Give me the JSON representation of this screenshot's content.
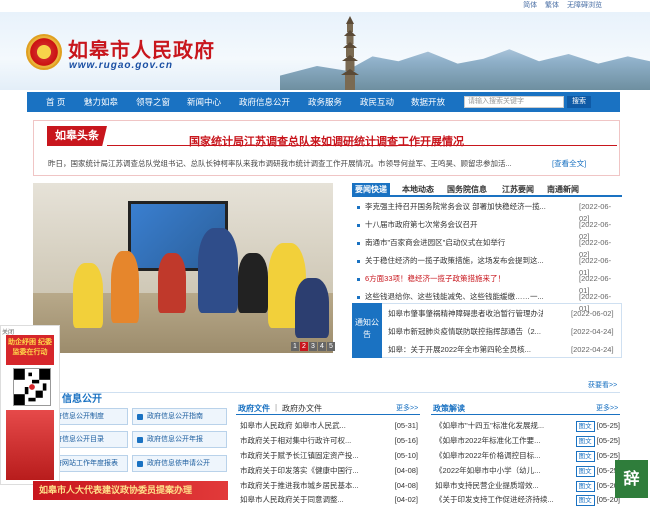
{
  "topstrip": {
    "simplified": "简体",
    "traditional": "繁体",
    "accessibility": "无障碍浏览"
  },
  "site": {
    "title": "如皋市人民政府",
    "url": "www.rugao.gov.cn"
  },
  "nav": {
    "items": [
      "首 页",
      "魅力如皋",
      "领导之窗",
      "新闻中心",
      "政府信息公开",
      "政务服务",
      "政民互动",
      "数据开放"
    ],
    "search_placeholder": "请输入搜索关键字",
    "search_button": "搜索"
  },
  "headline": {
    "tag": "如皋头条",
    "title": "国家统计局江苏调查总队来如调研统计调查工作开展情况",
    "summary": "昨日，国家统计局江苏调查总队党组书记、总队长钟柯率队来我市调研我市统计调查工作开展情况。市领导何益军、王鸣昊、顾留忠参加活...",
    "more": "[查看全文]"
  },
  "carousel": {
    "pages": [
      "1",
      "2",
      "3",
      "4",
      "5"
    ],
    "active": 1
  },
  "news_tabs": [
    "要闻快递",
    "本地动态",
    "国务院信息",
    "江苏要闻",
    "南通新闻"
  ],
  "news": [
    {
      "title": "李克强主持召开国务院常务会议 部署加快稳经济一揽...",
      "date": "[2022-06-02]"
    },
    {
      "title": "十八届市政府第七次常务会议召开",
      "date": "[2022-06-02]"
    },
    {
      "title": "南通市\"百家商会进园区\"启动仪式在如举行",
      "date": "[2022-06-02]"
    },
    {
      "title": "关于稳住经济的一揽子政策措施，这场发布会提到这...",
      "date": "[2022-06-01]"
    },
    {
      "title": "6方面33项！稳经济一揽子政策措施来了！",
      "date": "[2022-06-01]"
    },
    {
      "title": "这些钱退给你、这些钱能减免、这些钱能缓缴……一...",
      "date": "[2022-06-01]"
    }
  ],
  "notice": {
    "label": "通知公告",
    "items": [
      {
        "title": "如皋市肇事肇祸精神障碍患者收治暂行管理办法...",
        "date": "[2022-06-02]"
      },
      {
        "title": "如皋市新冠肺炎疫情联防联控指挥部通告（2...",
        "date": "[2022-04-24]"
      },
      {
        "title": "如皋：关于开展2022年全市第四轮全员核...",
        "date": "[2022-04-24]"
      }
    ]
  },
  "gov_info": {
    "title": "信息公开",
    "more": "获要看>>",
    "buttons": [
      "政府信息公开制度",
      "政府信息公开指南",
      "政府信息公开目录",
      "政府信息公开年报",
      "政府网站工作年度报表",
      "政府信息依申请公开"
    ]
  },
  "docs": {
    "tabs": [
      "政府文件",
      "政府办文件"
    ],
    "more": "更多>>",
    "items": [
      {
        "title": "如皋市人民政府 如皋市人民武...",
        "date": "[05-31]"
      },
      {
        "title": "市政府关于相对集中行政许可权...",
        "date": "[05-16]"
      },
      {
        "title": "市政府关于赋予长江镇固定资产投...",
        "date": "[05-10]"
      },
      {
        "title": "市政府关于印发落实《健康中国行...",
        "date": "[04-08]"
      },
      {
        "title": "市政府关于推进我市城乡居民基本...",
        "date": "[04-08]"
      },
      {
        "title": "如皋市人民政府关于同意调整...",
        "date": "[04-02]"
      }
    ]
  },
  "policy": {
    "title": "政策解读",
    "more": "更多>>",
    "tag": "图文",
    "items": [
      {
        "title": "《如皋市\"十四五\"标准化发展规...",
        "date": "[05-25]"
      },
      {
        "title": "《如皋市2022年标准化工作要...",
        "date": "[05-25]"
      },
      {
        "title": "《如皋市2022年价格调控目标...",
        "date": "[05-25]"
      },
      {
        "title": "《2022年如皋市中小学（幼儿...",
        "date": "[05-25]"
      },
      {
        "title": "如皋市支持民营企业提质增效...",
        "date": "[05-20]"
      },
      {
        "title": "《关于印发支持工作促进经济持续...",
        "date": "[05-20]"
      }
    ]
  },
  "qr": {
    "close": "关闭",
    "headline": "助企纾困 纪委监委在行动"
  },
  "banner": {
    "text": "如皋市人大代表建议政协委员提案办理"
  },
  "side_seal": {
    "text": "辞"
  }
}
